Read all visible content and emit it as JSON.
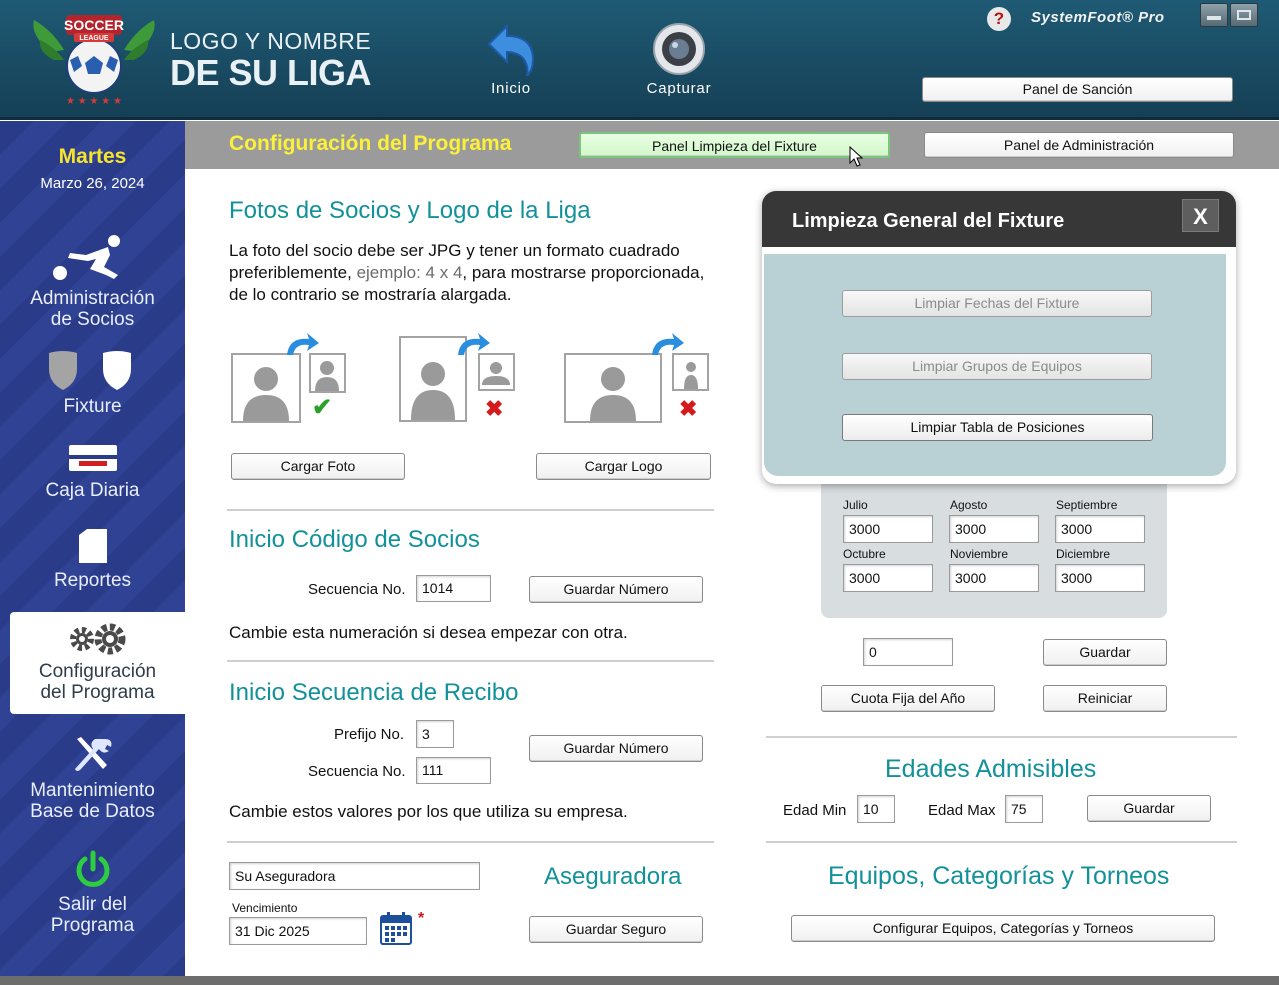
{
  "header": {
    "league_line1": "LOGO Y NOMBRE",
    "league_line2": "DE SU LIGA",
    "logo_badge_text": "SOCCER",
    "logo_badge_sub": "LEAGUE",
    "inicio_label": "Inicio",
    "capturar_label": "Capturar",
    "help_label": "?",
    "brand": "SystemFoot® Pro",
    "panel_sancion_label": "Panel de Sanción"
  },
  "sidebar": {
    "day": "Martes",
    "date": "Marzo 26, 2024",
    "items": [
      {
        "label1": "Administración",
        "label2": "de Socios"
      },
      {
        "label1": "Fixture",
        "label2": ""
      },
      {
        "label1": "Caja Diaria",
        "label2": ""
      },
      {
        "label1": "Reportes",
        "label2": ""
      },
      {
        "label1": "Configuración",
        "label2": "del Programa"
      },
      {
        "label1": "Mantenimiento",
        "label2": "Base de Datos"
      },
      {
        "label1": "Salir del",
        "label2": "Programa"
      }
    ]
  },
  "titlebar": {
    "title": "Configuración del Programa",
    "panel_limpieza": "Panel Limpieza del Fixture",
    "panel_admin": "Panel de Administración"
  },
  "fotos": {
    "title": "Fotos de Socios y Logo de la Liga",
    "text_a": "La foto del socio debe ser JPG y tener un formato cuadrado preferiblemente, ",
    "text_example": "ejemplo: 4 x 4",
    "text_b": ", para mostrarse proporcionada, de lo contrario se mostraría alargada.",
    "cargar_foto": "Cargar Foto",
    "cargar_logo": "Cargar Logo"
  },
  "codigo": {
    "title": "Inicio Código de Socios",
    "secuencia_label": "Secuencia No.",
    "secuencia_value": "1014",
    "guardar": "Guardar Número",
    "note": "Cambie esta numeración si desea empezar con otra."
  },
  "recibo": {
    "title": "Inicio Secuencia de Recibo",
    "prefijo_label": "Prefijo No.",
    "prefijo_value": "3",
    "secuencia_label": "Secuencia No.",
    "secuencia_value": "111",
    "guardar": "Guardar Número",
    "note": "Cambie estos valores por los que utiliza su empresa."
  },
  "aseguradora": {
    "title": "Aseguradora",
    "name_value": "Su Aseguradora",
    "vencimiento_label": "Vencimiento",
    "vencimiento_value": "31 Dic 2025",
    "required_mark": "*",
    "guardar": "Guardar Seguro"
  },
  "cuotas": {
    "months": [
      {
        "name": "Julio",
        "value": "3000"
      },
      {
        "name": "Agosto",
        "value": "3000"
      },
      {
        "name": "Septiembre",
        "value": "3000"
      },
      {
        "name": "Octubre",
        "value": "3000"
      },
      {
        "name": "Noviembre",
        "value": "3000"
      },
      {
        "name": "Diciembre",
        "value": "3000"
      }
    ],
    "fija_value": "0",
    "guardar": "Guardar",
    "cuota_fija": "Cuota Fija del Año",
    "reiniciar": "Reiniciar"
  },
  "edades": {
    "title": "Edades Admisibles",
    "min_label": "Edad Min",
    "min_value": "10",
    "max_label": "Edad Max",
    "max_value": "75",
    "guardar": "Guardar"
  },
  "equipos": {
    "title": "Equipos, Categorías y Torneos",
    "configurar": "Configurar Equipos, Categorías y Torneos"
  },
  "modal": {
    "title": "Limpieza General del Fixture",
    "close": "X",
    "btn_fechas": "Limpiar Fechas del Fixture",
    "btn_grupos": "Limpiar Grupos de Equipos",
    "btn_tabla": "Limpiar Tabla de Posiciones"
  },
  "colors": {
    "header_bg": "#1f5a74",
    "sidebar_bg": "#2a3b8a",
    "title_yellow": "#fbf03a",
    "section_teal": "#12919a",
    "modal_body": "#b9d0d5"
  }
}
